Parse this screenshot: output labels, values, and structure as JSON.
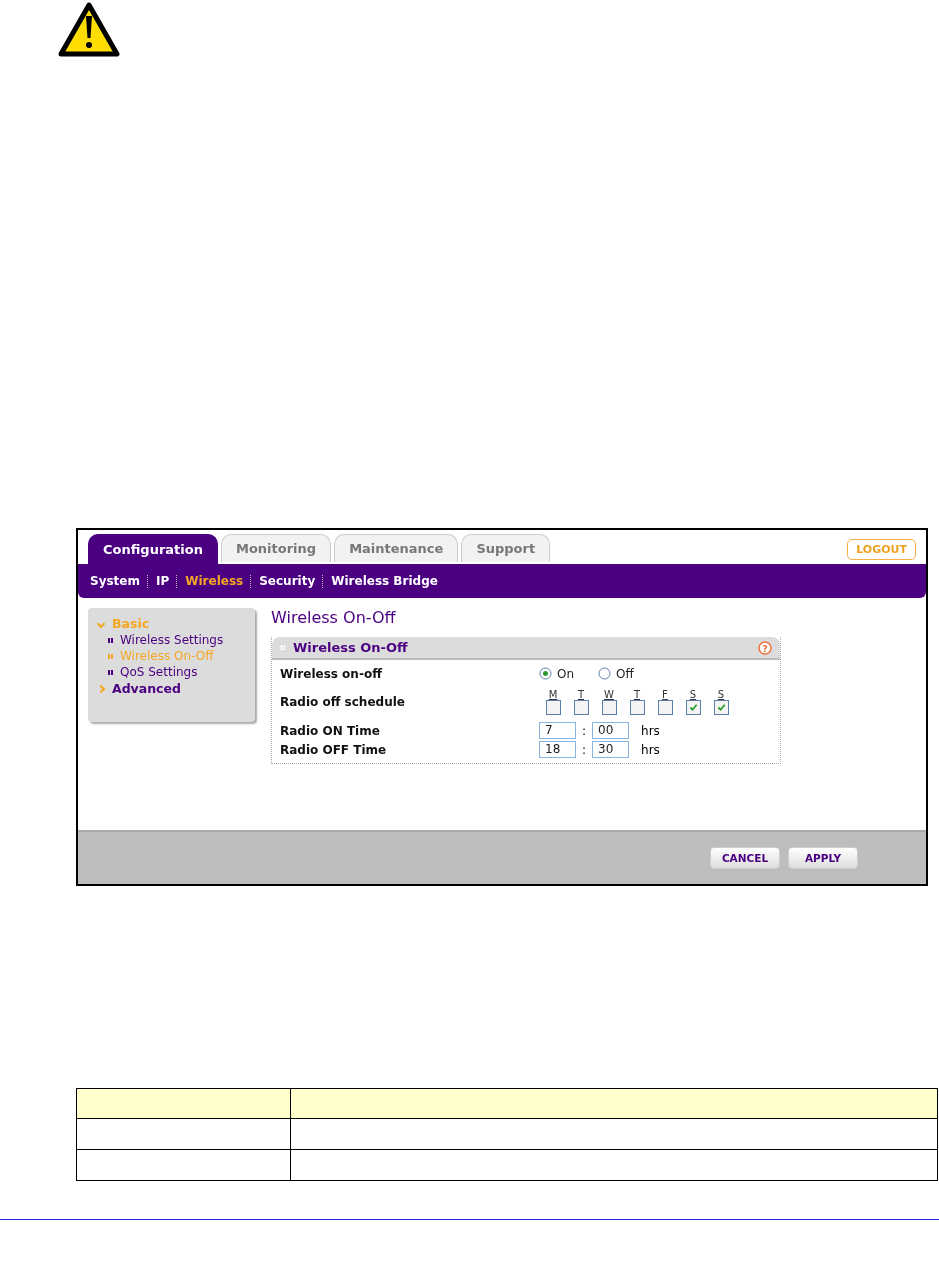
{
  "tabs": [
    {
      "label": "Configuration",
      "selected": true
    },
    {
      "label": "Monitoring",
      "selected": false
    },
    {
      "label": "Maintenance",
      "selected": false
    },
    {
      "label": "Support",
      "selected": false
    }
  ],
  "logout": "LOGOUT",
  "subnav": [
    {
      "label": "System",
      "selected": false
    },
    {
      "label": "IP",
      "selected": false
    },
    {
      "label": "Wireless",
      "selected": true
    },
    {
      "label": "Security",
      "selected": false
    },
    {
      "label": "Wireless Bridge",
      "selected": false
    }
  ],
  "sidebar": {
    "items": [
      {
        "label": "Basic",
        "expanded": true,
        "children": [
          {
            "label": "Wireless Settings",
            "selected": false
          },
          {
            "label": "Wireless On-Off",
            "selected": true
          },
          {
            "label": "QoS Settings",
            "selected": false
          }
        ]
      },
      {
        "label": "Advanced",
        "expanded": false
      }
    ]
  },
  "page_title": "Wireless On-Off",
  "panel": {
    "title": "Wireless On-Off",
    "help": "?",
    "rows": [
      {
        "kind": "radio",
        "label": "Wireless on-off",
        "options": [
          {
            "label": "On",
            "selected": true
          },
          {
            "label": "Off",
            "selected": false
          }
        ]
      },
      {
        "kind": "days",
        "label": "Radio off schedule",
        "days": [
          {
            "label": "M",
            "checked": false
          },
          {
            "label": "T",
            "checked": false
          },
          {
            "label": "W",
            "checked": false
          },
          {
            "label": "T",
            "checked": false
          },
          {
            "label": "F",
            "checked": false
          },
          {
            "label": "S",
            "checked": true
          },
          {
            "label": "S",
            "checked": true
          }
        ]
      },
      {
        "kind": "time",
        "label": "Radio ON Time",
        "hours": "7",
        "separator": ":",
        "minutes": "00",
        "unit": "hrs"
      },
      {
        "kind": "time",
        "label": "Radio OFF Time",
        "hours": "18",
        "separator": ":",
        "minutes": "30",
        "unit": "hrs"
      }
    ]
  },
  "buttons": [
    "CANCEL",
    "APPLY"
  ]
}
